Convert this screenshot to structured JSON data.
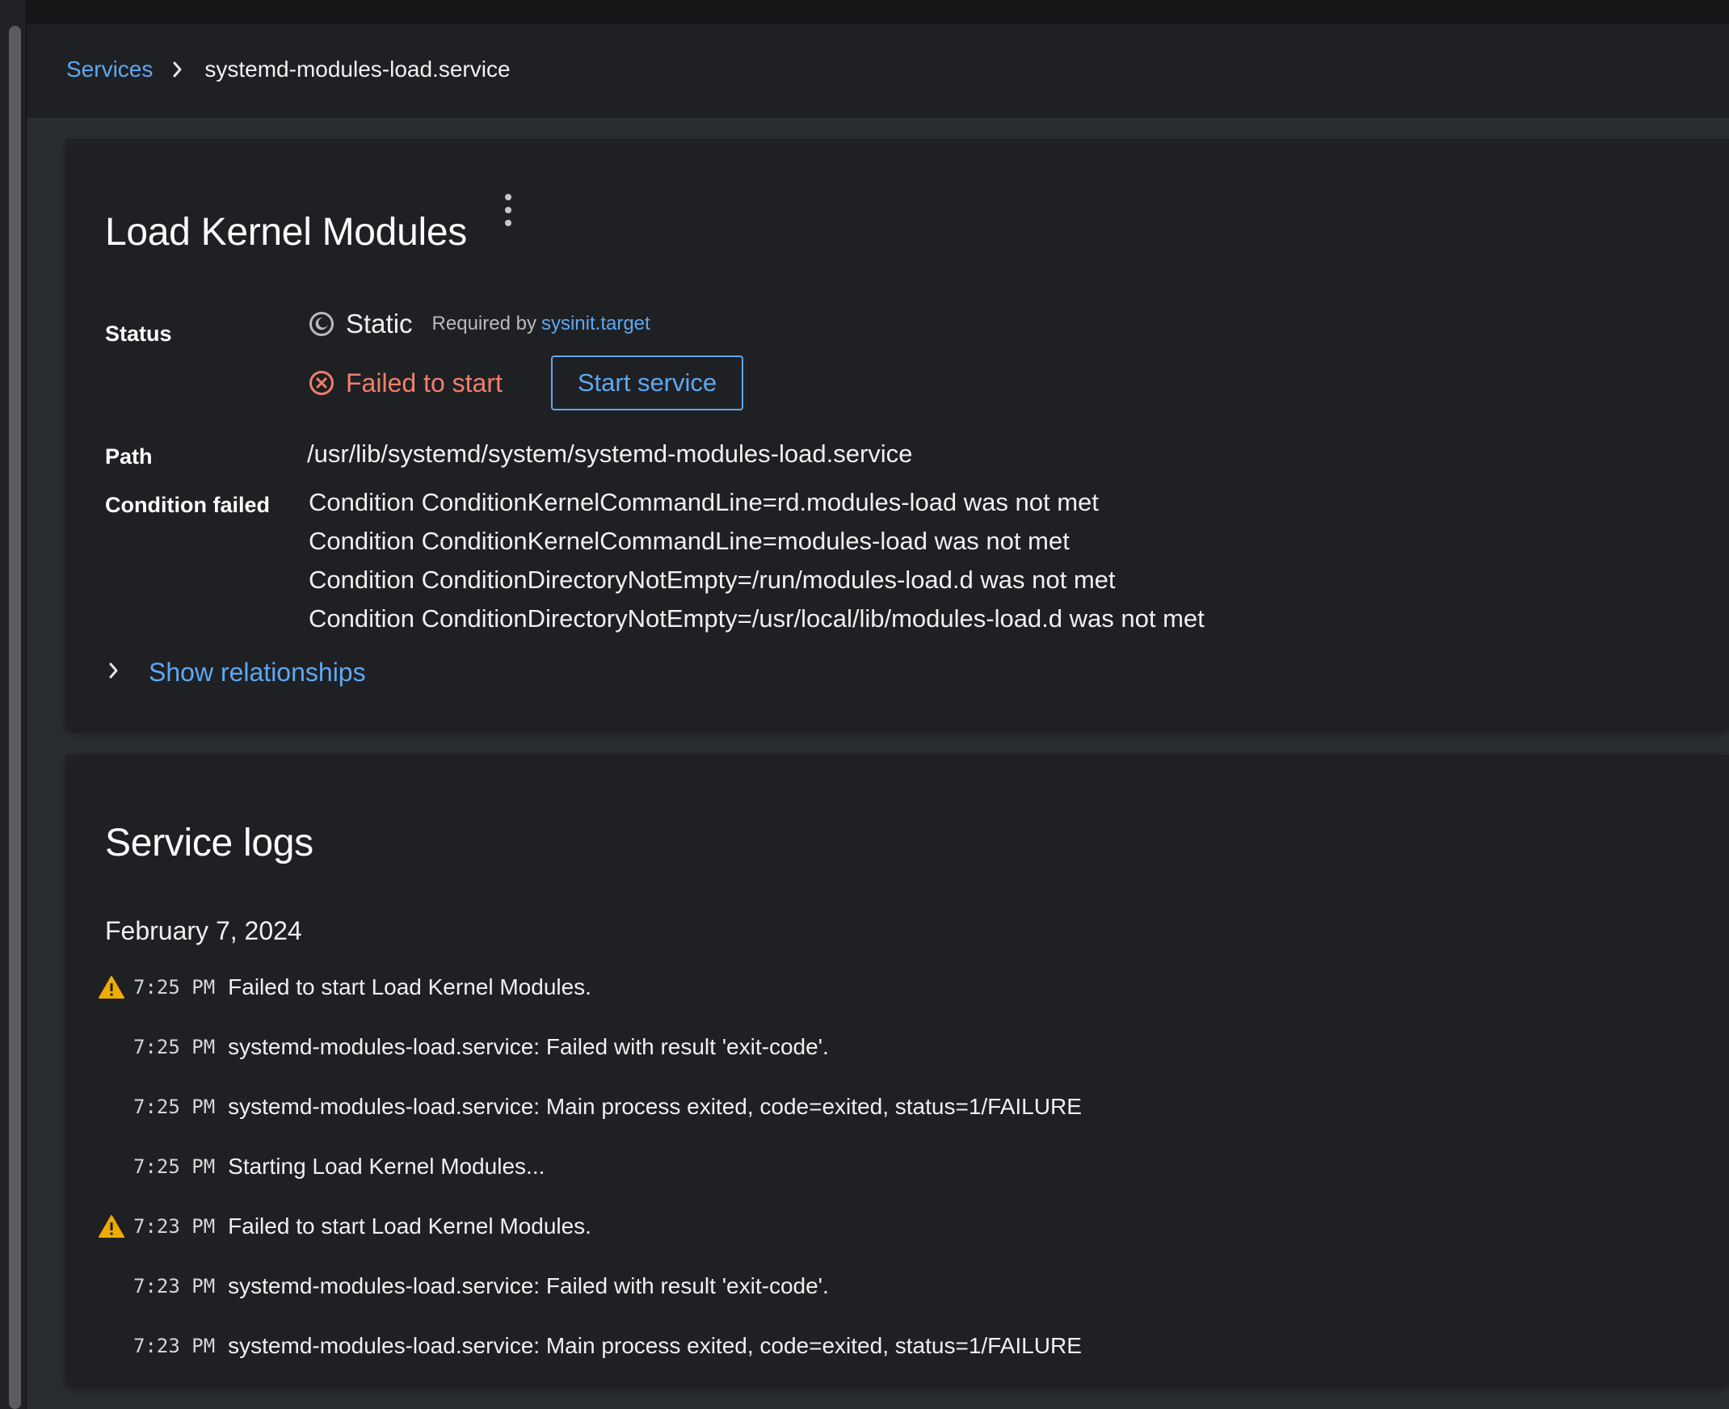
{
  "breadcrumb": {
    "parent": "Services",
    "current": "systemd-modules-load.service"
  },
  "service": {
    "title": "Load Kernel Modules",
    "status_label": "Status",
    "static_text": "Static",
    "required_by_label": "Required by",
    "required_by_link": "sysinit.target",
    "failed_text": "Failed to start",
    "start_button": "Start service",
    "path_label": "Path",
    "path_value": "/usr/lib/systemd/system/systemd-modules-load.service",
    "condition_label": "Condition failed",
    "conditions": [
      "Condition ConditionKernelCommandLine=rd.modules-load was not met",
      "Condition ConditionKernelCommandLine=modules-load was not met",
      "Condition ConditionDirectoryNotEmpty=/run/modules-load.d was not met",
      "Condition ConditionDirectoryNotEmpty=/usr/local/lib/modules-load.d was not met"
    ],
    "relationships_toggle": "Show relationships"
  },
  "logs": {
    "title": "Service logs",
    "date": "February 7, 2024",
    "entries": [
      {
        "warning": true,
        "time": "7:25 PM",
        "message": "Failed to start Load Kernel Modules."
      },
      {
        "warning": false,
        "time": "7:25 PM",
        "message": "systemd-modules-load.service: Failed with result 'exit-code'."
      },
      {
        "warning": false,
        "time": "7:25 PM",
        "message": "systemd-modules-load.service: Main process exited, code=exited, status=1/FAILURE"
      },
      {
        "warning": false,
        "time": "7:25 PM",
        "message": "Starting Load Kernel Modules..."
      },
      {
        "warning": true,
        "time": "7:23 PM",
        "message": "Failed to start Load Kernel Modules."
      },
      {
        "warning": false,
        "time": "7:23 PM",
        "message": "systemd-modules-load.service: Failed with result 'exit-code'."
      },
      {
        "warning": false,
        "time": "7:23 PM",
        "message": "systemd-modules-load.service: Main process exited, code=exited, status=1/FAILURE"
      }
    ]
  },
  "colors": {
    "link": "#5ea8f0",
    "danger": "#f0806b",
    "warning": "#f0ab00",
    "card_bg": "#1f2024",
    "page_bg": "#292c31"
  },
  "icons": {
    "breadcrumb_separator": "chevron-right-icon",
    "static": "static-icon",
    "failed": "error-circle-icon",
    "kebab": "kebab-icon",
    "toggle": "chevron-right-icon",
    "warning": "warning-triangle-icon"
  }
}
